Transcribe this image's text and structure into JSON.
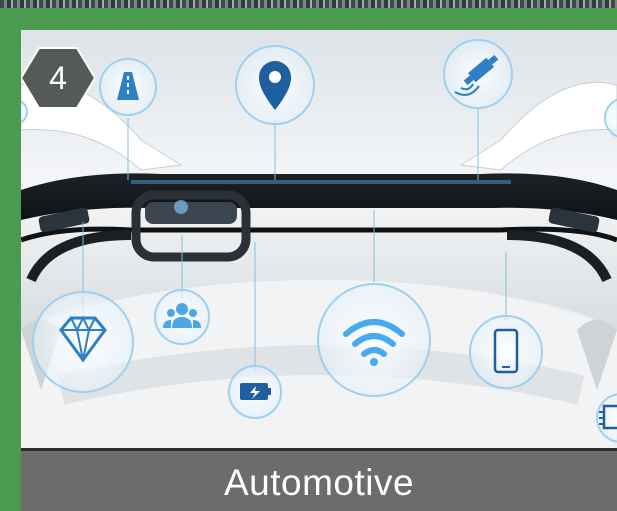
{
  "slide": {
    "number": "4",
    "caption": "Automotive"
  },
  "icons": [
    "road-icon",
    "location-pin-icon",
    "satellite-icon",
    "diamond-icon",
    "people-icon",
    "battery-charging-icon",
    "wifi-icon",
    "smartphone-icon",
    "chip-icon"
  ],
  "colors": {
    "frame_green": "#4a9a4f",
    "caption_bar": "#6a6d6c",
    "badge": "#555958",
    "icon_blue": "#2f7fc4",
    "icon_line": "#7ec0e6"
  }
}
